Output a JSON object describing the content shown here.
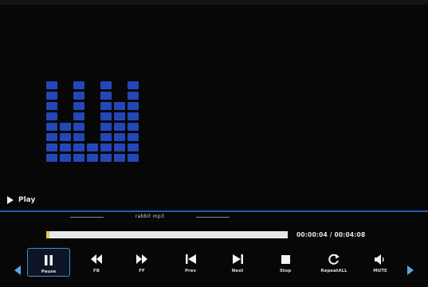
{
  "status": {
    "state_label": "Play"
  },
  "track": {
    "filename": "rabbit mp3"
  },
  "progress": {
    "fraction": 0.013,
    "time_text": "00:00:04 / 00:04:08"
  },
  "visualizer": {
    "levels": [
      8,
      4,
      8,
      2,
      8,
      6,
      8
    ]
  },
  "controls": [
    {
      "label": "Pause",
      "icon": "pause-icon",
      "selected": true
    },
    {
      "label": "FB",
      "icon": "fast-backward-icon"
    },
    {
      "label": "FF",
      "icon": "fast-forward-icon"
    },
    {
      "label": "Prev",
      "icon": "previous-icon"
    },
    {
      "label": "Next",
      "icon": "next-icon"
    },
    {
      "label": "Stop",
      "icon": "stop-icon"
    },
    {
      "label": "RepeatALL",
      "icon": "repeat-icon"
    },
    {
      "label": "MUTE",
      "icon": "mute-icon"
    }
  ],
  "colors": {
    "visualizer": "#2447b8",
    "accent": "#1e5fb0",
    "progress": "#e8c54a"
  }
}
